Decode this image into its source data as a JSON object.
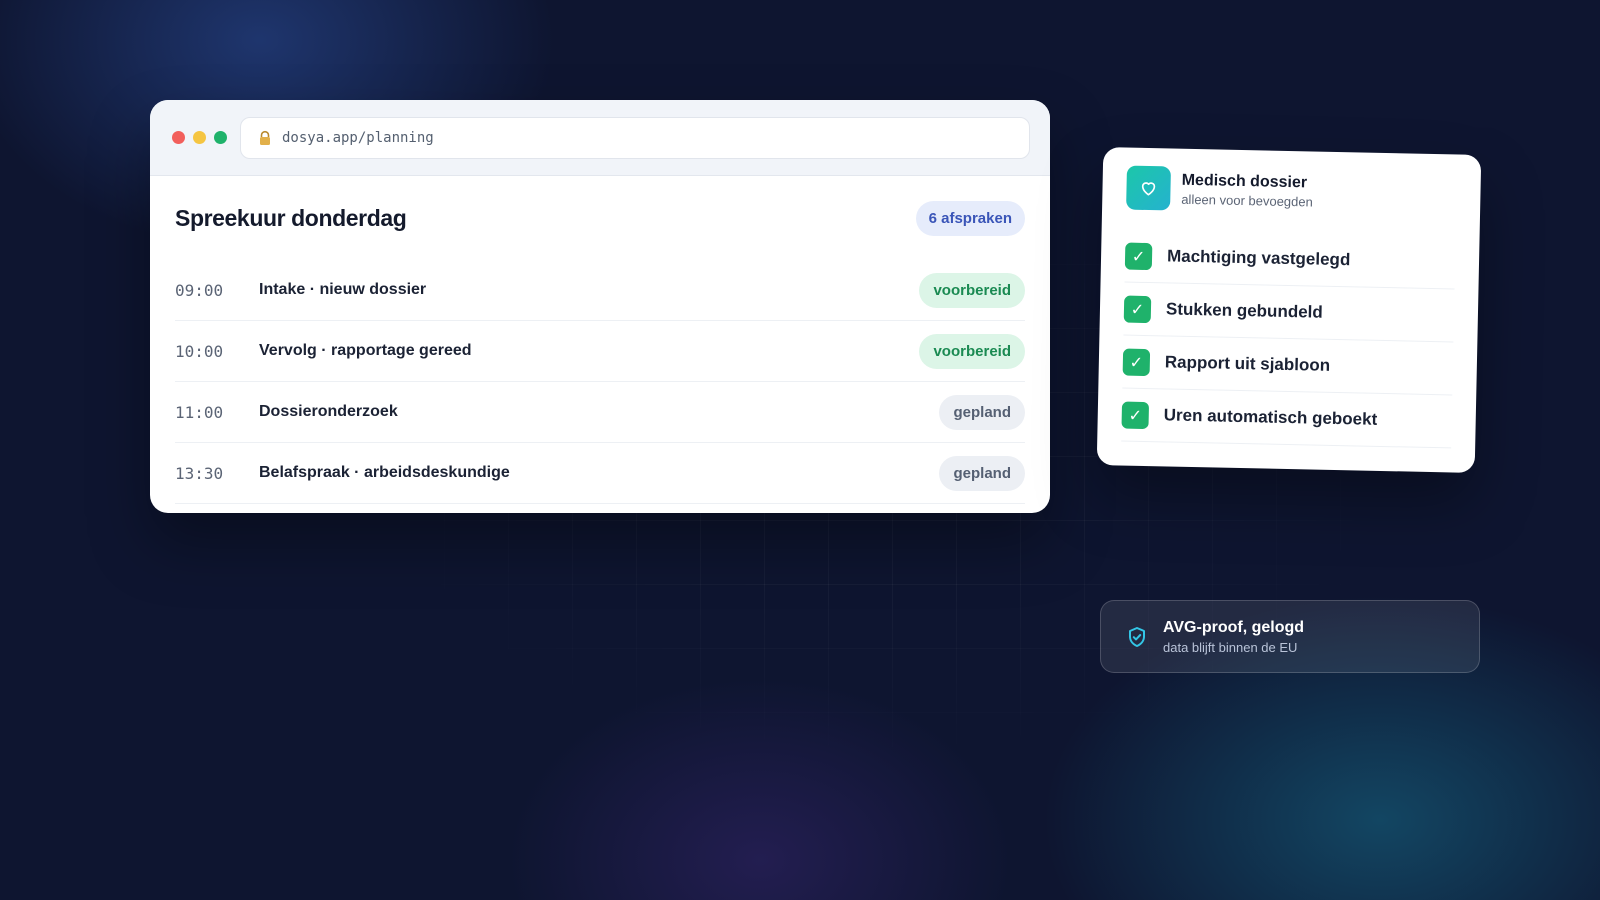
{
  "browser": {
    "url": "dosya.app/planning",
    "title": "Spreekuur donderdag",
    "count_badge": "6 afspraken",
    "appointments": [
      {
        "time": "09:00",
        "title": "Intake · nieuw dossier",
        "status": "voorbereid"
      },
      {
        "time": "10:00",
        "title": "Vervolg · rapportage gereed",
        "status": "voorbereid"
      },
      {
        "time": "11:00",
        "title": "Dossieronderzoek",
        "status": "gepland"
      },
      {
        "time": "13:30",
        "title": "Belafspraak · arbeidsdeskundige",
        "status": "gepland"
      }
    ]
  },
  "dossier": {
    "icon": "heart-icon",
    "title": "Medisch dossier",
    "subtitle": "alleen voor bevoegden",
    "checks": [
      {
        "label": "Machtiging vastgelegd",
        "mark": "✓"
      },
      {
        "label": "Stukken gebundeld",
        "mark": "✓"
      },
      {
        "label": "Rapport uit sjabloon",
        "mark": "✓"
      },
      {
        "label": "Uren automatisch geboekt",
        "mark": "✓"
      }
    ]
  },
  "avg": {
    "icon": "shield-check-icon",
    "title": "AVG-proof, gelogd",
    "subtitle": "data blijft binnen de EU"
  },
  "colors": {
    "background": "#0e1530",
    "accent_green": "#1fb26b",
    "accent_teal": "#1cc7a9",
    "badge_blue": "#3a55b8"
  }
}
